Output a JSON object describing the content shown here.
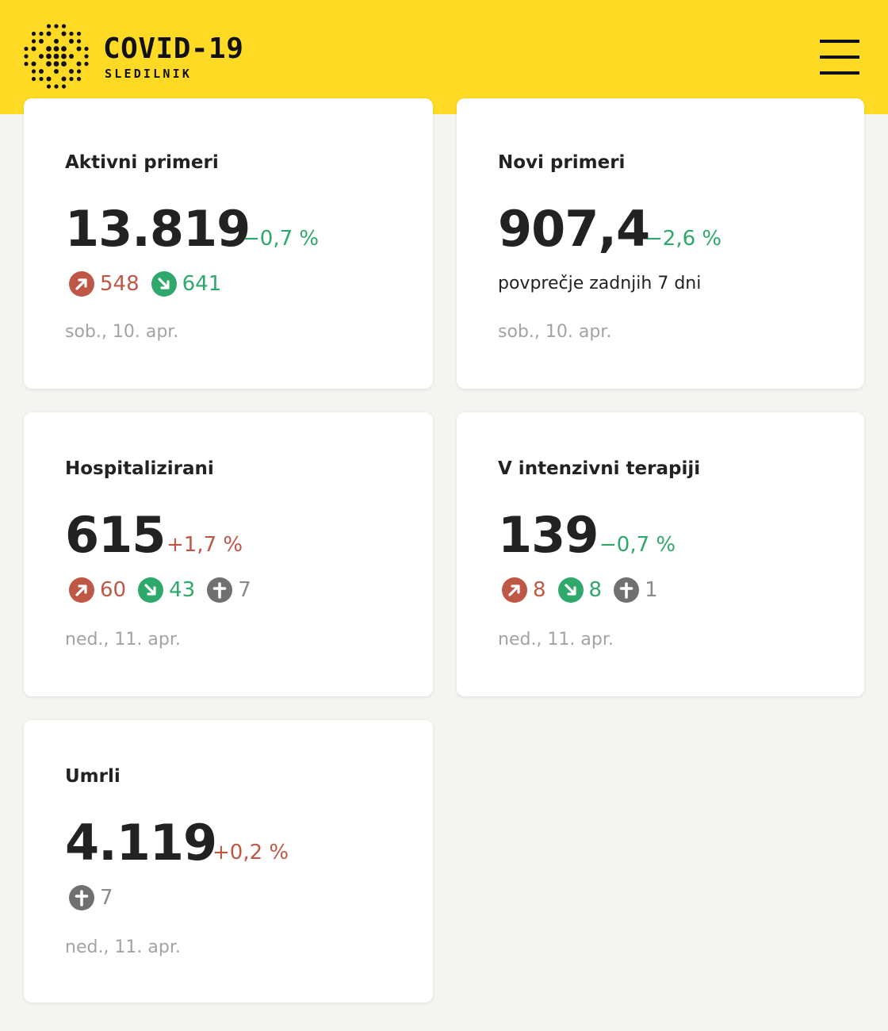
{
  "header": {
    "brand_title": "COVID-19",
    "brand_subtitle": "SLEDILNIK",
    "logo_icon": "dot-grid-logo-icon",
    "menu_icon": "hamburger-menu-icon",
    "bg_color": "#ffda24"
  },
  "colors": {
    "up": "#bf5747",
    "down": "#2ea86b",
    "deceased": "#707070"
  },
  "cards": {
    "active": {
      "title": "Aktivni primeri",
      "value": "13.819",
      "pct": "−0,7 %",
      "up": "548",
      "down": "641",
      "date": "sob., 10. apr."
    },
    "new": {
      "title": "Novi primeri",
      "value": "907,4",
      "pct": "−2,6 %",
      "subtitle": "povprečje zadnjih 7 dni",
      "date": "sob., 10. apr."
    },
    "hospital": {
      "title": "Hospitalizirani",
      "value": "615",
      "pct": "+1,7 %",
      "up": "60",
      "down": "43",
      "deceased": "7",
      "date": "ned., 11. apr."
    },
    "icu": {
      "title": "V intenzivni terapiji",
      "value": "139",
      "pct": "−0,7 %",
      "up": "8",
      "down": "8",
      "deceased": "1",
      "date": "ned., 11. apr."
    },
    "deaths": {
      "title": "Umrli",
      "value": "4.119",
      "pct": "+0,2 %",
      "deceased": "7",
      "date": "ned., 11. apr."
    }
  }
}
